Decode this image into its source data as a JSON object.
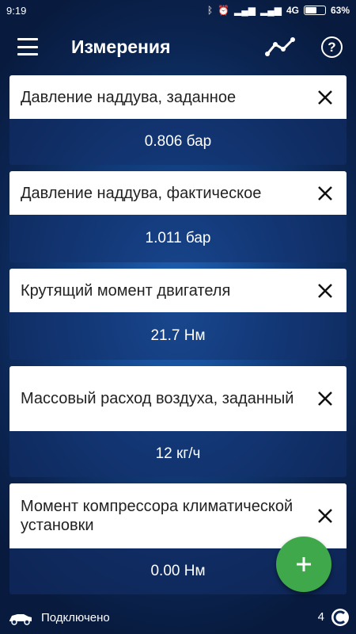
{
  "status": {
    "time": "9:19",
    "network": "4G",
    "battery": "63%",
    "battery_level": 0.63
  },
  "header": {
    "title": "Измерения",
    "icons": [
      "menu-icon",
      "line-chart-icon",
      "help-icon"
    ]
  },
  "measurements": [
    {
      "label": "Давление наддува, заданное",
      "value": "0.806 бар"
    },
    {
      "label": "Давление наддува, фактическое",
      "value": "1.011 бар"
    },
    {
      "label": "Крутящий момент двигателя",
      "value": "21.7 Нм"
    },
    {
      "label": "Массовый расход воздуха, заданный",
      "value": "12 кг/ч"
    },
    {
      "label": "Момент компрессора климатической установки",
      "value": "0.00 Нм"
    }
  ],
  "footer": {
    "connection": "Подключено",
    "count": "4"
  },
  "colors": {
    "fab": "#3ea84a",
    "background": "#123f80"
  }
}
